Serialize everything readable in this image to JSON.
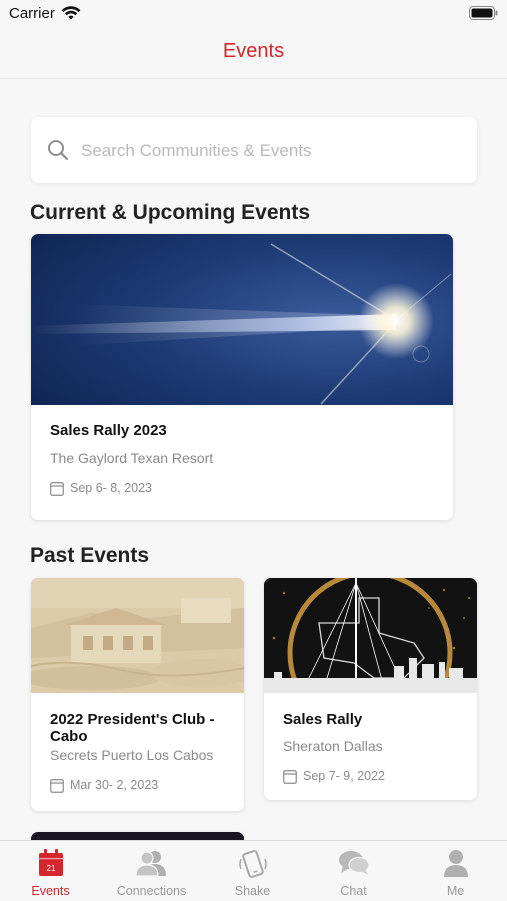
{
  "status_bar": {
    "carrier": "Carrier"
  },
  "nav": {
    "title": "Events"
  },
  "search": {
    "placeholder": "Search Communities & Events",
    "value": ""
  },
  "sections": {
    "current_title": "Current & Upcoming Events",
    "past_title": "Past Events"
  },
  "current_events": [
    {
      "title": "Sales Rally 2023",
      "location": "The Gaylord Texan Resort",
      "dates": "Sep 6- 8, 2023"
    }
  ],
  "past_events": [
    {
      "title": "2022 President's Club - Cabo",
      "location": "Secrets Puerto Los Cabos",
      "dates": "Mar 30- 2, 2023"
    },
    {
      "title": "Sales Rally",
      "location": "Sheraton Dallas",
      "dates": "Sep 7- 9, 2022"
    }
  ],
  "tab_bar": {
    "calendar_day": "21",
    "tabs": [
      {
        "label": "Events",
        "icon": "calendar-icon",
        "active": true
      },
      {
        "label": "Connections",
        "icon": "people-icon",
        "active": false
      },
      {
        "label": "Shake",
        "icon": "phone-shake-icon",
        "active": false
      },
      {
        "label": "Chat",
        "icon": "chat-bubbles-icon",
        "active": false
      },
      {
        "label": "Me",
        "icon": "person-icon",
        "active": false
      }
    ]
  },
  "colors": {
    "accent": "#d4262c",
    "inactive": "#9a9a9a",
    "background": "#f7f7f7"
  }
}
